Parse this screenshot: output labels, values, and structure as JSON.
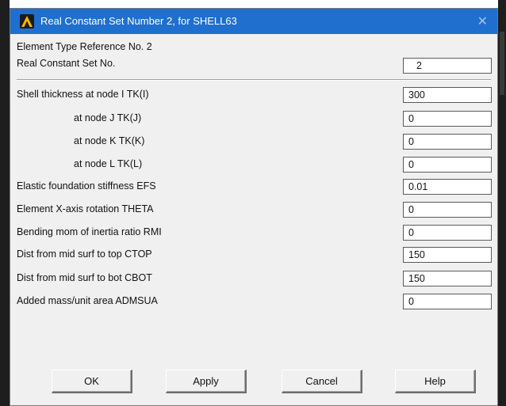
{
  "window": {
    "title": "Real Constant Set Number 2, for SHELL63",
    "close_glyph": "✕",
    "icon": "ansys-logo-icon",
    "title_bar_color": "#1f6fcf"
  },
  "header": {
    "element_type_ref": "Element Type Reference No. 2",
    "real_const_label": "Real Constant Set No.",
    "real_const_value": "2"
  },
  "fields": [
    {
      "label": "Shell thickness at node I  TK(I)",
      "value": "300"
    },
    {
      "label": "at node J  TK(J)",
      "value": "0"
    },
    {
      "label": "at node K  TK(K)",
      "value": "0"
    },
    {
      "label": "at node L  TK(L)",
      "value": "0"
    },
    {
      "label": "Elastic foundation stiffness EFS",
      "value": "0.01"
    },
    {
      "label": "Element X-axis rotation    THETA",
      "value": "0"
    },
    {
      "label": "Bending mom of inertia ratio RMI",
      "value": "0"
    },
    {
      "label": "Dist from mid surf to top   CTOP",
      "value": "150"
    },
    {
      "label": "Dist from mid surf to bot   CBOT",
      "value": "150"
    },
    {
      "label": "Added mass/unit area     ADMSUA",
      "value": "0"
    }
  ],
  "buttons": {
    "ok": "OK",
    "apply": "Apply",
    "cancel": "Cancel",
    "help": "Help"
  }
}
